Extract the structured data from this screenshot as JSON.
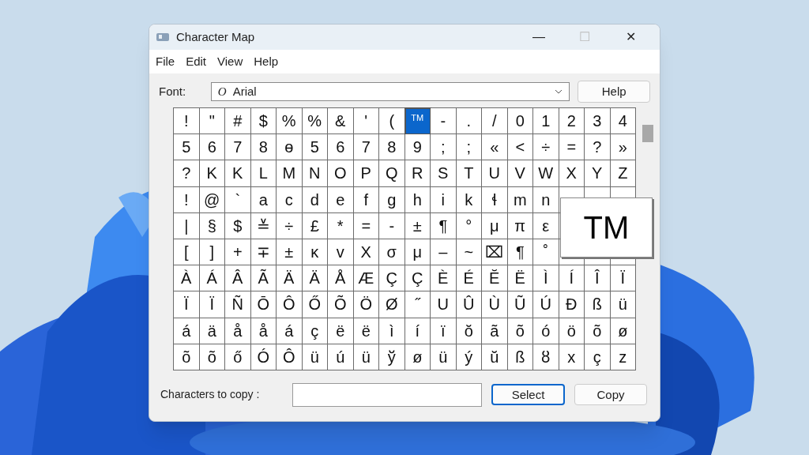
{
  "window": {
    "title": "Character Map",
    "controls": [
      "—",
      "☐",
      "✕"
    ]
  },
  "menu": [
    {
      "label": "File"
    },
    {
      "label": "Edit"
    },
    {
      "label": "View"
    },
    {
      "label": "Help"
    }
  ],
  "font": {
    "label": "Font:",
    "glyph": "O",
    "value": "Arial",
    "help_button": "Help"
  },
  "grid": {
    "rows": [
      [
        {
          "c": "!",
          "selected": false
        },
        {
          "c": "\"",
          "selected": false
        },
        {
          "c": "#",
          "selected": false
        },
        {
          "c": "$",
          "selected": false
        },
        {
          "c": "%",
          "selected": false
        },
        {
          "c": "%",
          "selected": false
        },
        {
          "c": "&",
          "selected": false
        },
        {
          "c": "'",
          "selected": false
        },
        {
          "c": "(",
          "selected": false
        },
        {
          "c": "TM",
          "selected": true
        },
        {
          "c": "-",
          "selected": false
        },
        {
          "c": ".",
          "selected": false
        },
        {
          "c": "/",
          "selected": false
        },
        {
          "c": "0",
          "selected": false
        },
        {
          "c": "1",
          "selected": false
        },
        {
          "c": "2",
          "selected": false
        },
        {
          "c": "3",
          "selected": false
        },
        {
          "c": "4",
          "selected": false
        }
      ],
      [
        {
          "c": "5",
          "selected": false
        },
        {
          "c": "6",
          "selected": false
        },
        {
          "c": "7",
          "selected": false
        },
        {
          "c": "8",
          "selected": false
        },
        {
          "c": "ɵ",
          "selected": false
        },
        {
          "c": "5",
          "selected": false
        },
        {
          "c": "6",
          "selected": false
        },
        {
          "c": "7",
          "selected": false
        },
        {
          "c": "8",
          "selected": false
        },
        {
          "c": "9",
          "selected": false
        },
        {
          "c": ";",
          "selected": false
        },
        {
          "c": ";",
          "selected": false
        },
        {
          "c": "«",
          "selected": false
        },
        {
          "c": "<",
          "selected": false
        },
        {
          "c": "÷",
          "selected": false
        },
        {
          "c": "=",
          "selected": false
        },
        {
          "c": "?",
          "selected": false
        },
        {
          "c": "»",
          "selected": false
        }
      ],
      [
        {
          "c": "?",
          "selected": false
        },
        {
          "c": "K",
          "selected": false
        },
        {
          "c": "K",
          "selected": false
        },
        {
          "c": "L",
          "selected": false
        },
        {
          "c": "M",
          "selected": false
        },
        {
          "c": "N",
          "selected": false
        },
        {
          "c": "O",
          "selected": false
        },
        {
          "c": "P",
          "selected": false
        },
        {
          "c": "Q",
          "selected": false
        },
        {
          "c": "R",
          "selected": false
        },
        {
          "c": "S",
          "selected": false
        },
        {
          "c": "T",
          "selected": false
        },
        {
          "c": "U",
          "selected": false
        },
        {
          "c": "V",
          "selected": false
        },
        {
          "c": "W",
          "selected": false
        },
        {
          "c": "X",
          "selected": false
        },
        {
          "c": "Y",
          "selected": false
        },
        {
          "c": "Z",
          "selected": false
        }
      ],
      [
        {
          "c": "!",
          "selected": false
        },
        {
          "c": "@",
          "selected": false
        },
        {
          "c": "`",
          "selected": false
        },
        {
          "c": "a",
          "selected": false
        },
        {
          "c": "c",
          "selected": false
        },
        {
          "c": "d",
          "selected": false
        },
        {
          "c": "e",
          "selected": false
        },
        {
          "c": "f",
          "selected": false
        },
        {
          "c": "g",
          "selected": false
        },
        {
          "c": "h",
          "selected": false
        },
        {
          "c": "i",
          "selected": false
        },
        {
          "c": "k",
          "selected": false
        },
        {
          "c": "ɬ",
          "selected": false
        },
        {
          "c": "m",
          "selected": false
        },
        {
          "c": "n",
          "selected": false
        },
        null,
        null,
        null
      ],
      [
        {
          "c": "|",
          "selected": false
        },
        {
          "c": "§",
          "selected": false
        },
        {
          "c": "$",
          "selected": false
        },
        {
          "c": "≚",
          "selected": false
        },
        {
          "c": "÷",
          "selected": false
        },
        {
          "c": "£",
          "selected": false
        },
        {
          "c": "*",
          "selected": false
        },
        {
          "c": "=",
          "selected": false
        },
        {
          "c": "-",
          "selected": false
        },
        {
          "c": "±",
          "selected": false
        },
        {
          "c": "¶",
          "selected": false
        },
        {
          "c": "°",
          "selected": false
        },
        {
          "c": "μ",
          "selected": false
        },
        {
          "c": "π",
          "selected": false
        },
        {
          "c": "ε",
          "selected": false
        },
        null,
        null,
        null
      ],
      [
        {
          "c": "[",
          "selected": false
        },
        {
          "c": "]",
          "selected": false
        },
        {
          "c": "+",
          "selected": false
        },
        {
          "c": "∓",
          "selected": false
        },
        {
          "c": "±",
          "selected": false
        },
        {
          "c": "κ",
          "selected": false
        },
        {
          "c": "v",
          "selected": false
        },
        {
          "c": "Χ",
          "selected": false
        },
        {
          "c": "σ",
          "selected": false
        },
        {
          "c": "μ",
          "selected": false
        },
        {
          "c": "–",
          "selected": false
        },
        {
          "c": "~",
          "selected": false
        },
        {
          "c": "⌧",
          "selected": false
        },
        {
          "c": "¶",
          "selected": false
        },
        {
          "c": "˚",
          "selected": false
        },
        null,
        null,
        null
      ],
      [
        {
          "c": "À",
          "selected": false
        },
        {
          "c": "Á",
          "selected": false
        },
        {
          "c": "Â",
          "selected": false
        },
        {
          "c": "Ã",
          "selected": false
        },
        {
          "c": "Ä",
          "selected": false
        },
        {
          "c": "Ä",
          "selected": false
        },
        {
          "c": "Å",
          "selected": false
        },
        {
          "c": "Æ",
          "selected": false
        },
        {
          "c": "Ç",
          "selected": false
        },
        {
          "c": "Ç",
          "selected": false
        },
        {
          "c": "È",
          "selected": false
        },
        {
          "c": "É",
          "selected": false
        },
        {
          "c": "Ĕ",
          "selected": false
        },
        {
          "c": "Ë",
          "selected": false
        },
        {
          "c": "Ì",
          "selected": false
        },
        {
          "c": "Í",
          "selected": false
        },
        {
          "c": "Î",
          "selected": false
        },
        {
          "c": "Ï",
          "selected": false
        }
      ],
      [
        {
          "c": "Ï",
          "selected": false
        },
        {
          "c": "Ï",
          "selected": false
        },
        {
          "c": "Ñ",
          "selected": false
        },
        {
          "c": "Ō",
          "selected": false
        },
        {
          "c": "Ô",
          "selected": false
        },
        {
          "c": "Ő",
          "selected": false
        },
        {
          "c": "Õ",
          "selected": false
        },
        {
          "c": "Ö",
          "selected": false
        },
        {
          "c": "Ø",
          "selected": false
        },
        {
          "c": "˝",
          "selected": false
        },
        {
          "c": "U",
          "selected": false
        },
        {
          "c": "Û",
          "selected": false
        },
        {
          "c": "Ù",
          "selected": false
        },
        {
          "c": "Ũ",
          "selected": false
        },
        {
          "c": "Ú",
          "selected": false
        },
        {
          "c": "Đ",
          "selected": false
        },
        {
          "c": "ß",
          "selected": false
        },
        {
          "c": "ü",
          "selected": false
        }
      ],
      [
        {
          "c": "á",
          "selected": false
        },
        {
          "c": "ä",
          "selected": false
        },
        {
          "c": "å",
          "selected": false
        },
        {
          "c": "å",
          "selected": false
        },
        {
          "c": "á",
          "selected": false
        },
        {
          "c": "ç",
          "selected": false
        },
        {
          "c": "ë",
          "selected": false
        },
        {
          "c": "ë",
          "selected": false
        },
        {
          "c": "ì",
          "selected": false
        },
        {
          "c": "í",
          "selected": false
        },
        {
          "c": "ï",
          "selected": false
        },
        {
          "c": "ŏ",
          "selected": false
        },
        {
          "c": "ã",
          "selected": false
        },
        {
          "c": "õ",
          "selected": false
        },
        {
          "c": "ó",
          "selected": false
        },
        {
          "c": "ö",
          "selected": false
        },
        {
          "c": "õ",
          "selected": false
        },
        {
          "c": "ø",
          "selected": false
        }
      ],
      [
        {
          "c": "õ",
          "selected": false
        },
        {
          "c": "õ",
          "selected": false
        },
        {
          "c": "ő",
          "selected": false
        },
        {
          "c": "Ó",
          "selected": false
        },
        {
          "c": "Ô",
          "selected": false
        },
        {
          "c": "ü",
          "selected": false
        },
        {
          "c": "ú",
          "selected": false
        },
        {
          "c": "ü",
          "selected": false
        },
        {
          "c": "ў",
          "selected": false
        },
        {
          "c": "ø",
          "selected": false
        },
        {
          "c": "ü",
          "selected": false
        },
        {
          "c": "ý",
          "selected": false
        },
        {
          "c": "ŭ",
          "selected": false
        },
        {
          "c": "ß",
          "selected": false
        },
        {
          "c": "ȣ",
          "selected": false
        },
        {
          "c": "x",
          "selected": false
        },
        {
          "c": "ç",
          "selected": false
        },
        {
          "c": "z",
          "selected": false
        }
      ]
    ],
    "magnified": "TM"
  },
  "copy": {
    "label": "Characters to copy :",
    "select_button": "Select",
    "copy_button": "Copy"
  }
}
